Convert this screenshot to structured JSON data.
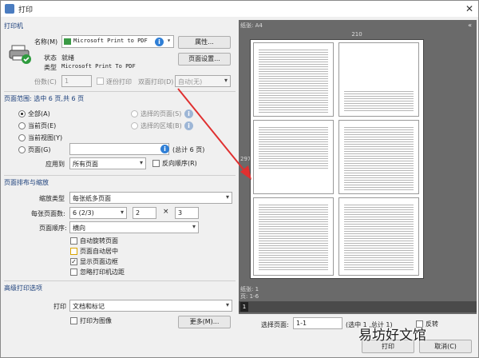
{
  "window": {
    "title": "打印"
  },
  "printer": {
    "section_label": "打印机",
    "name_label": "名称(M)",
    "name_value": "Microsoft Print to PDF",
    "properties_btn": "属性...",
    "page_setup_btn": "页面设置...",
    "status_label": "状态",
    "status_value": "就绪",
    "type_label": "类型",
    "type_value": "Microsoft Print To PDF",
    "copies_label": "份数(C)",
    "copies_value": "1",
    "collate_label": "逐份打印",
    "duplex_label": "双面打印(D)",
    "duplex_value": "自动(无)"
  },
  "range": {
    "section_label": "页面范围: 选中 6 页,共 6 页",
    "all": "全部(A)",
    "current_page": "当前页(E)",
    "current_view": "当前视图(Y)",
    "pages": "页面(G)",
    "selected_pages": "选择的页面(S)",
    "selection": "选择的区域(B)",
    "total": "(总计 6 页)",
    "apply_label": "应用到",
    "apply_value": "所有页面",
    "reverse": "反向顺序(R)"
  },
  "layout": {
    "section_label": "页面排布与缩放",
    "scale_type_label": "缩放类型",
    "scale_type_value": "每张纸多页面",
    "pages_per_sheet_label": "每张页面数:",
    "pages_per_sheet_value": "6 (2/3)",
    "cols": "2",
    "times": "×",
    "rows": "3",
    "order_label": "页面顺序:",
    "order_value": "横向",
    "auto_rotate": "自动旋转页面",
    "auto_center": "页面自动居中",
    "show_border": "显示页面边框",
    "ignore_margins": "忽略打印机边距"
  },
  "advanced": {
    "section_label": "高级打印选项",
    "print_label": "打印",
    "print_value": "文档和标记",
    "as_image": "打印为图像",
    "more_btn": "更多(M)..."
  },
  "preview": {
    "paper_label": "纸张: A4",
    "width_label": "210",
    "height_label": "297",
    "sheet_label": "纸张: 1",
    "page_label": "页: 1-6",
    "pager_number": "1",
    "collapse": "«"
  },
  "footer": {
    "select_page_label": "选择页面:",
    "select_page_value": "1-1",
    "selected_info": "(选中 1 ,总计 1)",
    "reverse_label": "反转",
    "print_btn": "打印",
    "cancel_btn": "取消(C)"
  },
  "watermark": "易坊好文馆"
}
